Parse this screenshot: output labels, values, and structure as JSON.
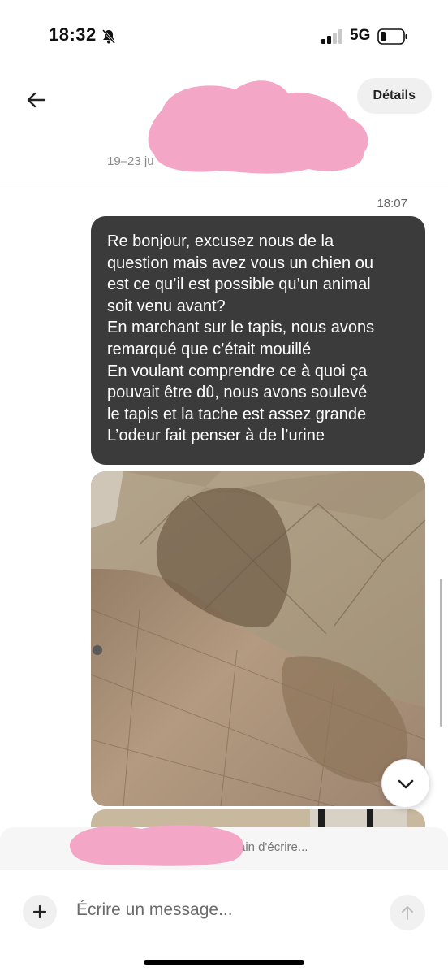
{
  "status_bar": {
    "time": "18:32",
    "network": "5G",
    "icons": [
      "bell-slash-icon",
      "signal-icon",
      "battery-icon"
    ]
  },
  "header": {
    "details_label": "Détails",
    "dates_visible": "19–23 ju",
    "back_icon": "arrow-left-icon"
  },
  "conversation": {
    "timestamp": "18:07",
    "message": "Re bonjour, excusez nous de la\nquestion mais avez vous un chien ou\nest ce qu’il est possible qu’un animal\nsoit venu avant?\nEn marchant sur le tapis, nous avons\nremarqué que c’était mouillé\nEn voulant comprendre ce à quoi ça\npouvait être dû, nous avons soulevé\nle tapis et la tache est assez grande\nL’odeur fait penser à de l’urine",
    "scroll_icon": "chevron-down-icon"
  },
  "typing": {
    "text": "ain d'écrire..."
  },
  "composer": {
    "placeholder": "Écrire un message...",
    "add_icon": "plus-icon",
    "send_icon": "arrow-up-icon"
  },
  "colors": {
    "bubble": "#3b3b3b",
    "redaction": "#f4a6c6",
    "button_bg": "#f0f0f0"
  }
}
